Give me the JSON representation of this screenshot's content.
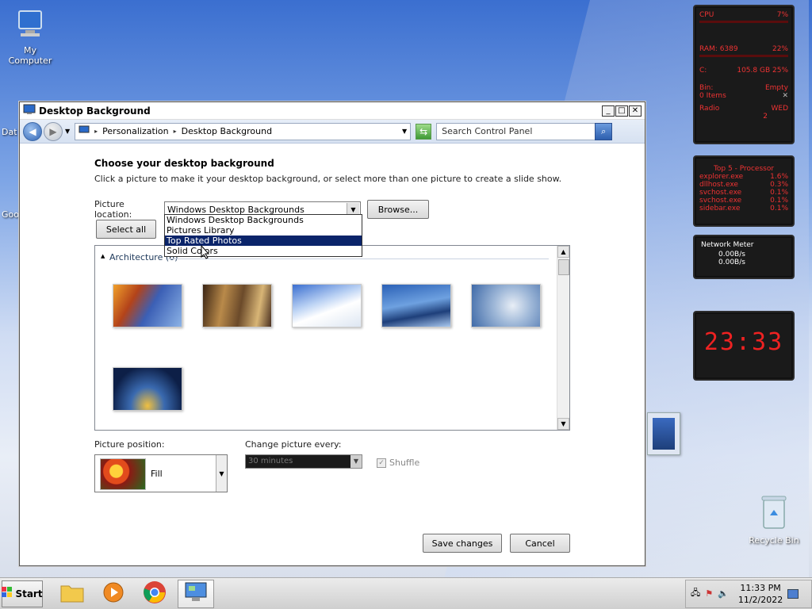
{
  "desktop": {
    "icons": [
      {
        "label": "My Computer"
      },
      {
        "label": "Recycle Bin"
      }
    ],
    "partial_labels": [
      "Data",
      "Goo"
    ]
  },
  "gadgets": {
    "system": {
      "cpu_label": "CPU",
      "cpu_value": "7%",
      "ram_label": "RAM: 6389",
      "ram_value": "22%",
      "disk_label": "C:",
      "disk_value": "105.8 GB 25%",
      "bin_label": "Bin:",
      "bin_value": "Empty",
      "bin_items": "0 Items",
      "radio_label": "Radio",
      "day": "WED",
      "date": "2"
    },
    "processes": {
      "title": "Top 5 - Processor",
      "rows": [
        {
          "name": "explorer.exe",
          "value": "1.6%"
        },
        {
          "name": "dllhost.exe",
          "value": "0.3%"
        },
        {
          "name": "svchost.exe",
          "value": "0.1%"
        },
        {
          "name": "svchost.exe",
          "value": "0.1%"
        },
        {
          "name": "sidebar.exe",
          "value": "0.1%"
        }
      ]
    },
    "network": {
      "title": "Network Meter",
      "down": "0.00B/s",
      "up": "0.00B/s"
    },
    "clock": {
      "time": "23:33"
    }
  },
  "window": {
    "title": "Desktop Background",
    "breadcrumb": [
      "Personalization",
      "Desktop Background"
    ],
    "search_placeholder": "Search Control Panel",
    "heading": "Choose your desktop background",
    "subheading": "Click a picture to make it your desktop background, or select more than one picture to create a slide show.",
    "picture_location_label": "Picture location:",
    "picture_location_value": "Windows Desktop Backgrounds",
    "browse_label": "Browse...",
    "select_all_label": "Select all",
    "dropdown_options": [
      {
        "label": "Windows Desktop Backgrounds",
        "selected": false
      },
      {
        "label": "Pictures Library",
        "selected": false
      },
      {
        "label": "Top Rated Photos",
        "selected": true
      },
      {
        "label": "Solid Colors",
        "selected": false
      }
    ],
    "group_title": "Architecture (6)",
    "picture_position_label": "Picture position:",
    "picture_position_value": "Fill",
    "change_picture_label": "Change picture every:",
    "change_picture_value": "30 minutes",
    "shuffle_label": "Shuffle",
    "save_label": "Save changes",
    "cancel_label": "Cancel"
  },
  "taskbar": {
    "start_label": "Start",
    "time": "11:33 PM",
    "date": "11/2/2022"
  }
}
